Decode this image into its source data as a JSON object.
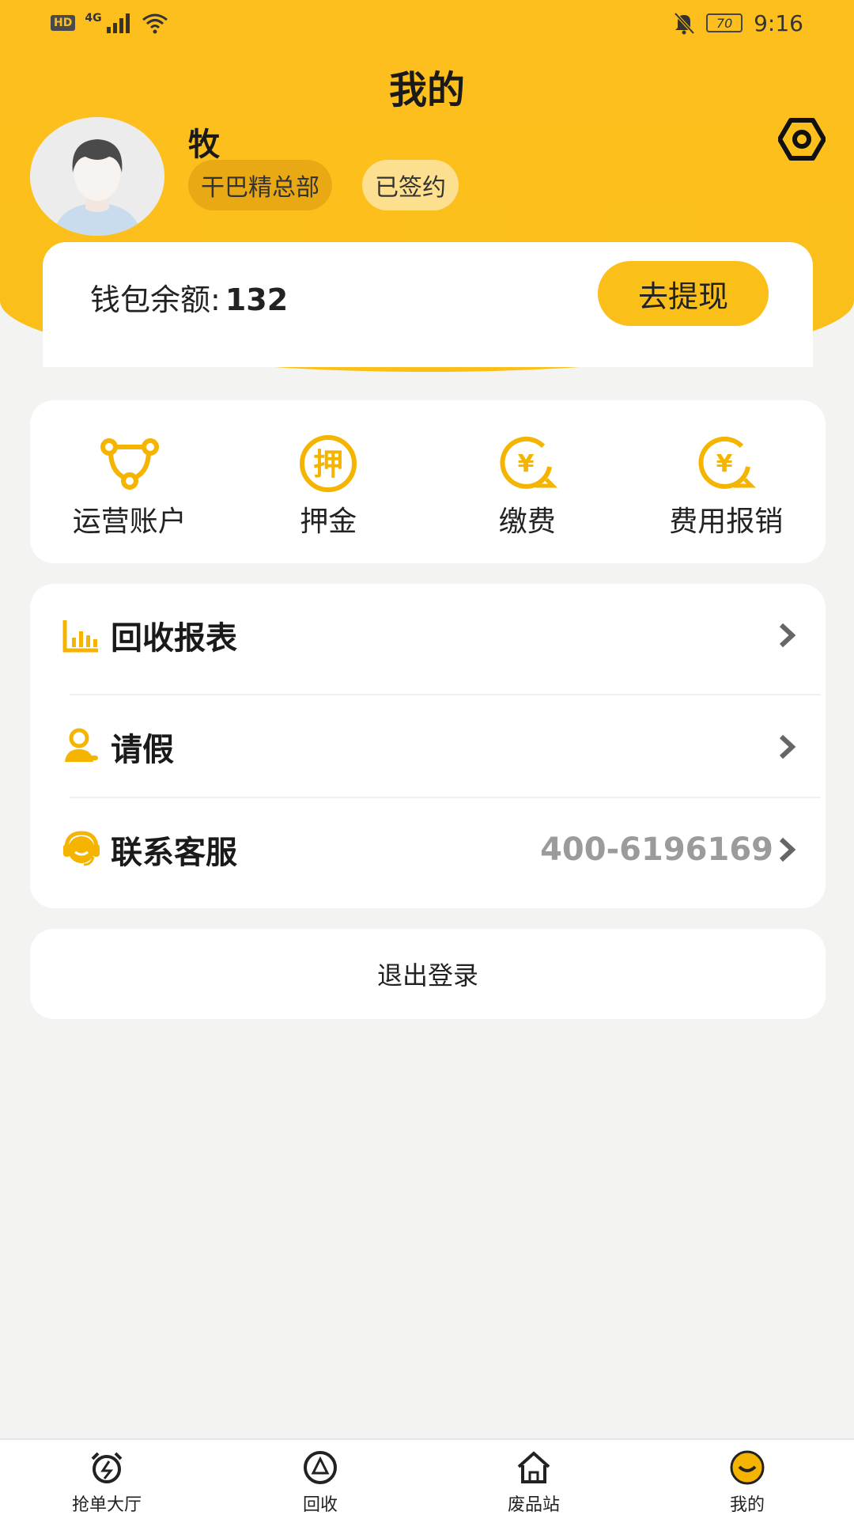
{
  "status_bar": {
    "hd": "HD",
    "network": "4G",
    "battery": "70",
    "time": "9:16"
  },
  "page_title": "我的",
  "user": {
    "name": "牧",
    "org_tag": "干巴精总部",
    "status_tag": "已签约"
  },
  "wallet": {
    "label": "钱包余额:",
    "value": "132",
    "withdraw_label": "去提现"
  },
  "quick_actions": [
    {
      "label": "运营账户",
      "icon": "share-nodes-icon"
    },
    {
      "label": "押金",
      "icon": "deposit-icon"
    },
    {
      "label": "缴费",
      "icon": "yuan-payment-icon"
    },
    {
      "label": "费用报销",
      "icon": "yuan-refund-icon"
    }
  ],
  "menu": {
    "report": {
      "label": "回收报表",
      "icon": "bar-chart-icon"
    },
    "leave": {
      "label": "请假",
      "icon": "person-icon"
    },
    "service": {
      "label": "联系客服",
      "icon": "headset-icon",
      "value": "400-6196169"
    }
  },
  "logout_label": "退出登录",
  "tabbar": [
    {
      "label": "抢单大厅",
      "icon": "alarm-clock-icon"
    },
    {
      "label": "回收",
      "icon": "recycle-icon"
    },
    {
      "label": "废品站",
      "icon": "house-icon"
    },
    {
      "label": "我的",
      "icon": "smile-icon"
    }
  ],
  "colors": {
    "accent": "#fbbf1a",
    "background": "#f3f3f2",
    "muted_text": "#9b9b9b"
  }
}
